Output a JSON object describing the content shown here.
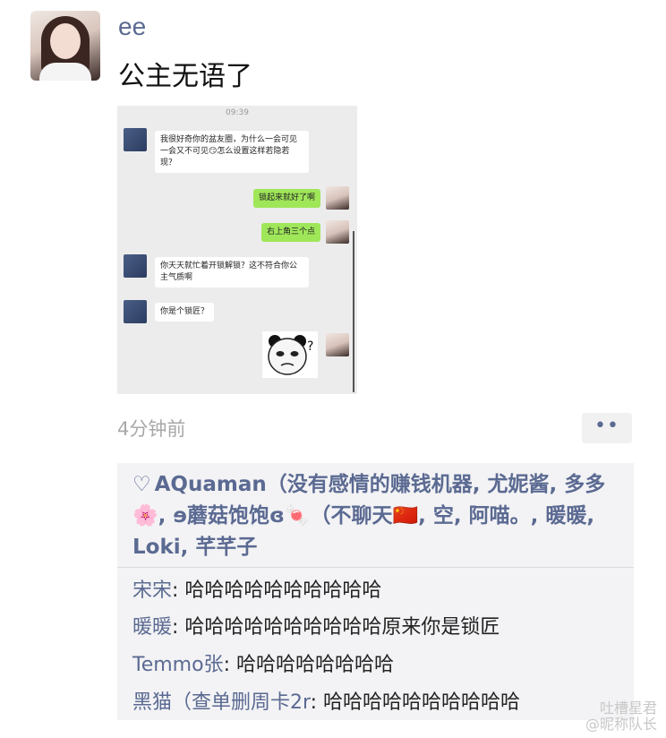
{
  "post": {
    "username": "ee",
    "text": "公主无语了",
    "time_ago": "4分钟前",
    "more_button": "••"
  },
  "screenshot": {
    "time": "09:39",
    "messages": [
      {
        "from": "left",
        "text": "我很好奇你的盆友圈，为什么一会可见一会又不可见😏怎么设置这样若隐若现？"
      },
      {
        "from": "right",
        "text": "锁起来就好了啊"
      },
      {
        "from": "right",
        "text": "右上角三个点"
      },
      {
        "from": "left",
        "text": "你天天就忙着开锁解锁？这不符合你公主气质啊"
      },
      {
        "from": "left",
        "text": "你是个锁匠？"
      }
    ],
    "sticker": "panda-question-sticker"
  },
  "likes": {
    "first": "AQuaman（没有感情的赚钱机器, 尤妮酱, 多多🌸, ɘ蘑菇饱饱ɞ🍬（不聊天🇨🇳, 空, 阿喵。, 暖暖, Loki, 芊芊子"
  },
  "comments": [
    {
      "who": "宋宋",
      "text": ": 哈哈哈哈哈哈哈哈哈哈"
    },
    {
      "who": "暖暖",
      "text": ": 哈哈哈哈哈哈哈哈哈哈原来你是锁匠"
    },
    {
      "who": "Temmo张",
      "text": ": 哈哈哈哈哈哈哈哈"
    },
    {
      "who": "黑猫（查单删周卡2r",
      "text": ": 哈哈哈哈哈哈哈哈哈哈"
    }
  ],
  "watermark": {
    "line1": "吐槽星君",
    "line2": "@昵称队长"
  }
}
